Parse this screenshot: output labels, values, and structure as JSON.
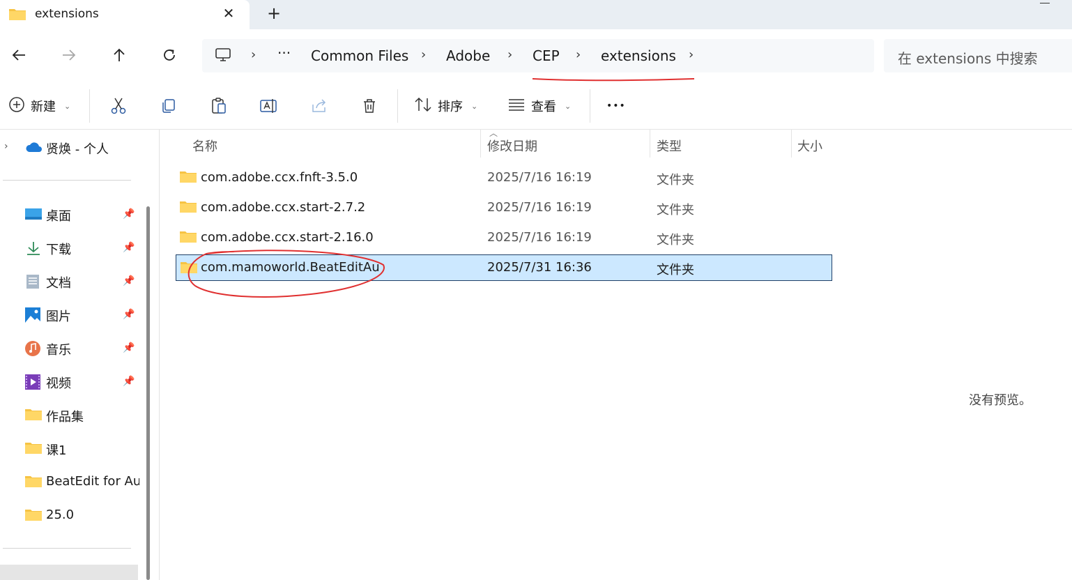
{
  "tab": {
    "title": "extensions",
    "close_glyph": "✕",
    "new_tab_glyph": "+"
  },
  "nav": {
    "back_icon": "arrow-left-icon",
    "forward_icon": "arrow-right-icon",
    "up_icon": "arrow-up-icon",
    "refresh_icon": "refresh-icon"
  },
  "breadcrumb": {
    "overflow": "···",
    "items": [
      "Common Files",
      "Adobe",
      "CEP",
      "extensions"
    ],
    "separator": "›"
  },
  "search": {
    "placeholder": "在 extensions 中搜索"
  },
  "toolbar": {
    "new_label": "新建",
    "sort_label": "排序",
    "view_label": "查看",
    "more_glyph": "•••"
  },
  "sidebar": {
    "onedrive_label": "贤焕 - 个人",
    "items": [
      {
        "label": "桌面",
        "pinned": true
      },
      {
        "label": "下载",
        "pinned": true
      },
      {
        "label": "文档",
        "pinned": true
      },
      {
        "label": "图片",
        "pinned": true
      },
      {
        "label": "音乐",
        "pinned": true
      },
      {
        "label": "视频",
        "pinned": true
      },
      {
        "label": "作品集",
        "pinned": false
      },
      {
        "label": "课1",
        "pinned": false
      },
      {
        "label": "BeatEdit for Audition",
        "pinned": false
      },
      {
        "label": "25.0",
        "pinned": false
      }
    ],
    "pin_glyph": "📌"
  },
  "columns": {
    "name": "名称",
    "date": "修改日期",
    "type": "类型",
    "size": "大小"
  },
  "files": [
    {
      "name": "com.adobe.ccx.fnft-3.5.0",
      "date": "2025/7/16 16:19",
      "type": "文件夹",
      "selected": false
    },
    {
      "name": "com.adobe.ccx.start-2.7.2",
      "date": "2025/7/16 16:19",
      "type": "文件夹",
      "selected": false
    },
    {
      "name": "com.adobe.ccx.start-2.16.0",
      "date": "2025/7/16 16:19",
      "type": "文件夹",
      "selected": false
    },
    {
      "name": "com.mamoworld.BeatEditAu",
      "date": "2025/7/31 16:36",
      "type": "文件夹",
      "selected": true
    }
  ],
  "preview": {
    "text": "没有预览。"
  },
  "colors": {
    "selection": "#cce8ff",
    "annotation": "#e03030",
    "folder": "#f6c344"
  }
}
